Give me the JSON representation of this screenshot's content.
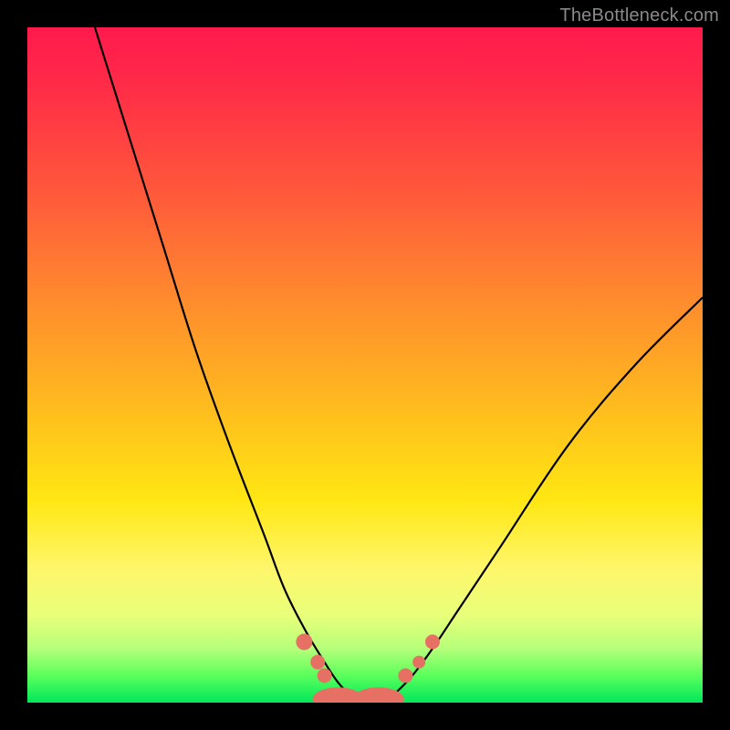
{
  "watermark": {
    "text": "TheBottleneck.com"
  },
  "chart_data": {
    "type": "line",
    "title": "",
    "xlabel": "",
    "ylabel": "",
    "xlim": [
      0,
      100
    ],
    "ylim": [
      0,
      100
    ],
    "grid": false,
    "legend": false,
    "background_gradient": {
      "direction": "vertical",
      "stops": [
        {
          "pos": 0,
          "color": "#ff1a4d"
        },
        {
          "pos": 25,
          "color": "#ff5a3a"
        },
        {
          "pos": 55,
          "color": "#ffb81f"
        },
        {
          "pos": 80,
          "color": "#fff66a"
        },
        {
          "pos": 92,
          "color": "#b6ff7a"
        },
        {
          "pos": 100,
          "color": "#00e85b"
        }
      ]
    },
    "series": [
      {
        "name": "bottleneck-curve",
        "description": "black V-shaped curve dipping to zero around x≈50 and rising on both sides",
        "color": "#000000",
        "x": [
          10,
          15,
          20,
          25,
          30,
          35,
          38,
          41,
          44,
          46,
          48,
          50,
          52,
          54,
          57,
          60,
          64,
          70,
          80,
          90,
          100
        ],
        "y": [
          100,
          84,
          68,
          52,
          38,
          25,
          17,
          11,
          6,
          3,
          1,
          0,
          0,
          1,
          4,
          8,
          14,
          23,
          38,
          50,
          60
        ]
      },
      {
        "name": "highlight-dots",
        "description": "salmon/pink rounded markers along the valley floor",
        "type": "scatter",
        "color": "#e77065",
        "points": [
          {
            "x": 41,
            "y": 9,
            "r": 9
          },
          {
            "x": 43,
            "y": 6,
            "r": 8
          },
          {
            "x": 44,
            "y": 4,
            "r": 8
          },
          {
            "x": 46,
            "y": 0.5,
            "r": 13,
            "rx": 28
          },
          {
            "x": 52,
            "y": 0.5,
            "r": 13,
            "rx": 28
          },
          {
            "x": 56,
            "y": 4,
            "r": 8
          },
          {
            "x": 58,
            "y": 6,
            "r": 7
          },
          {
            "x": 60,
            "y": 9,
            "r": 8
          }
        ]
      }
    ]
  }
}
